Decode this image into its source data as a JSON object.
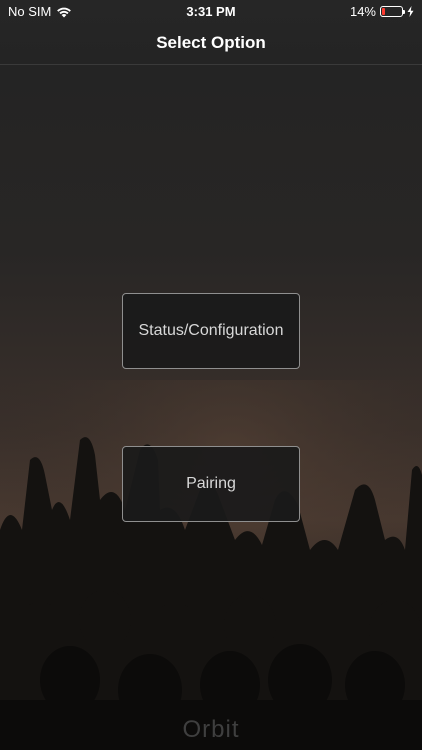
{
  "status_bar": {
    "carrier": "No SIM",
    "time": "3:31 PM",
    "battery_percent_label": "14%",
    "battery_level": 0.14,
    "battery_color": "#ff3b30",
    "icons": [
      "wifi-icon",
      "battery-icon",
      "charging-bolt-icon"
    ]
  },
  "nav": {
    "title": "Select Option"
  },
  "options": {
    "status_label": "Status/Configuration",
    "pairing_label": "Pairing"
  },
  "footer": {
    "brand": "Orbit"
  },
  "colors": {
    "background": "#262626",
    "button_border": "#8f8f8f",
    "button_text": "#d8d8d8"
  }
}
